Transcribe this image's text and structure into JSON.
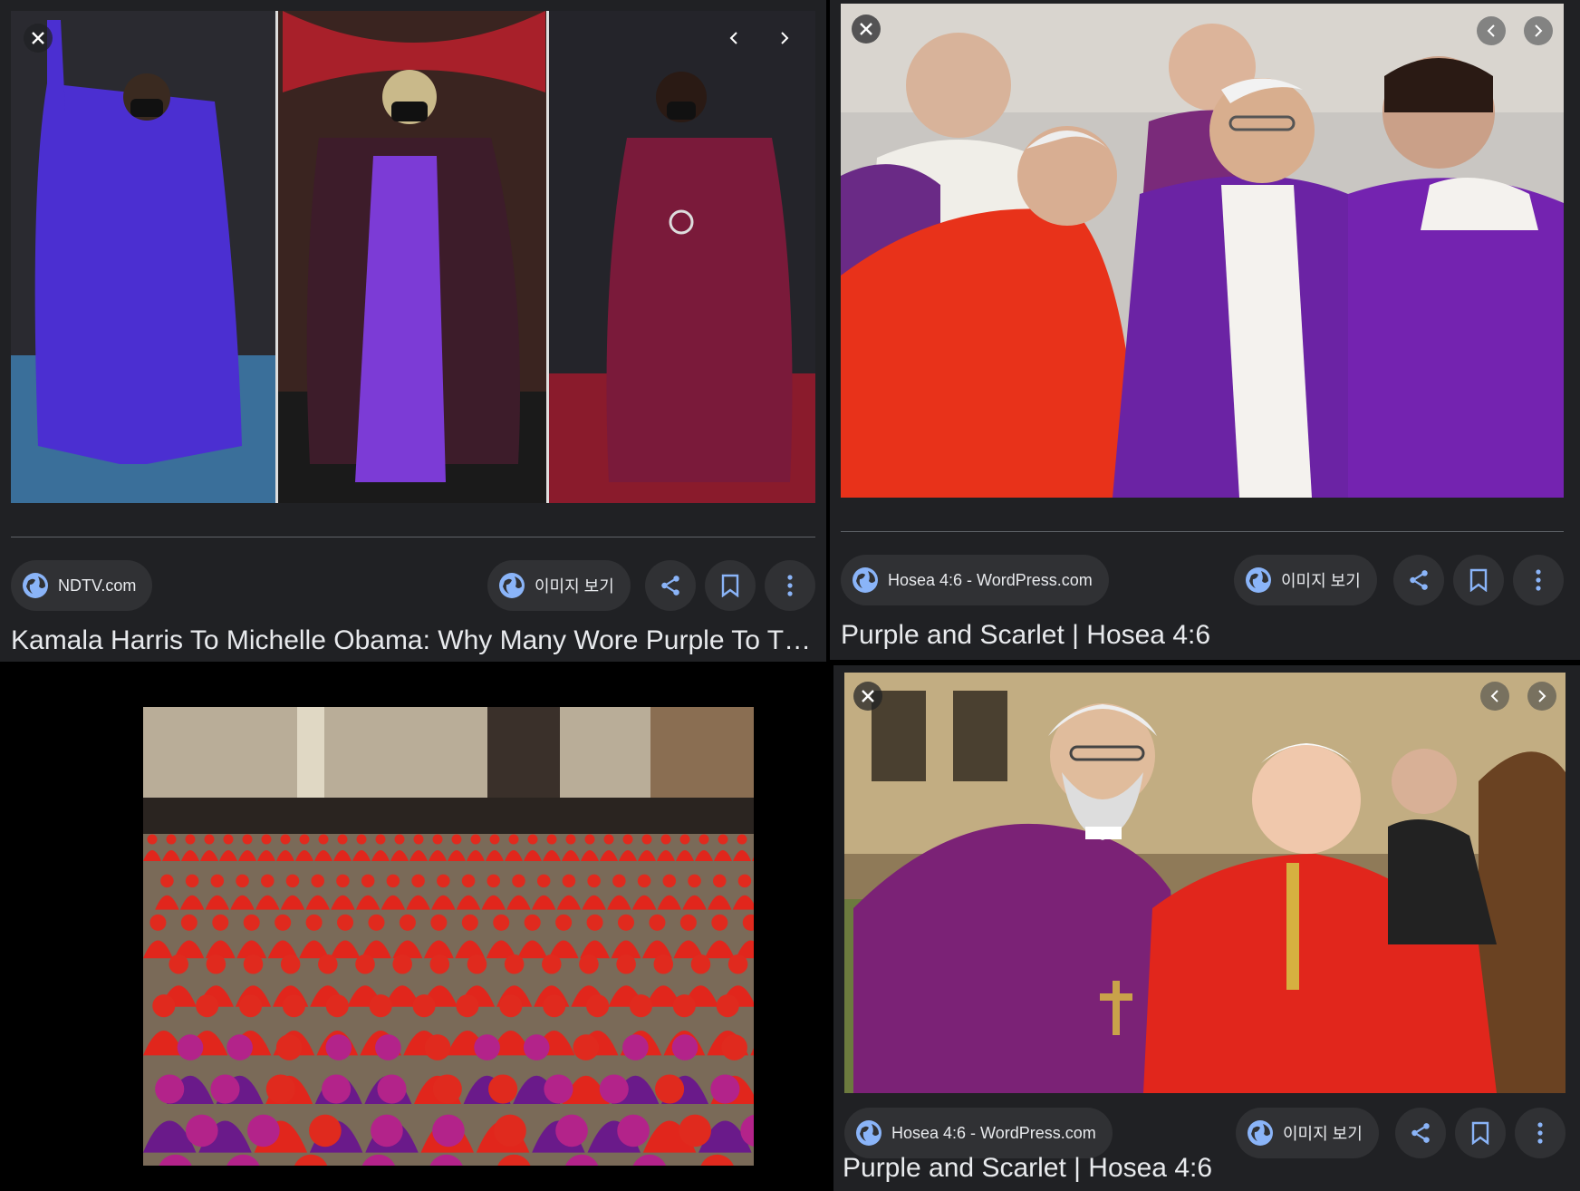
{
  "panels": {
    "ndtv": {
      "source": "NDTV.com",
      "view_image_label": "이미지 보기",
      "title": "Kamala Harris To Michelle Obama: Why Many Wore Purple To Th..."
    },
    "hosea_top": {
      "source": "Hosea 4:6 - WordPress.com",
      "view_image_label": "이미지 보기",
      "title": "Purple and Scarlet | Hosea 4:6"
    },
    "hosea_bottom": {
      "source": "Hosea 4:6 - WordPress.com",
      "view_image_label": "이미지 보기",
      "title": "Purple and Scarlet | Hosea 4:6"
    }
  },
  "icons": {
    "close": "close-icon",
    "prev": "chevron-left-icon",
    "next": "chevron-right-icon",
    "globe": "globe-icon",
    "share": "share-icon",
    "bookmark": "bookmark-icon",
    "more": "more-vert-icon"
  },
  "colors": {
    "panel_bg": "#202124",
    "chip_bg": "#303134",
    "text": "#e8eaed",
    "accent_blue": "#8ab4f8",
    "purple": "#6a1a8a",
    "scarlet": "#e1261c"
  }
}
